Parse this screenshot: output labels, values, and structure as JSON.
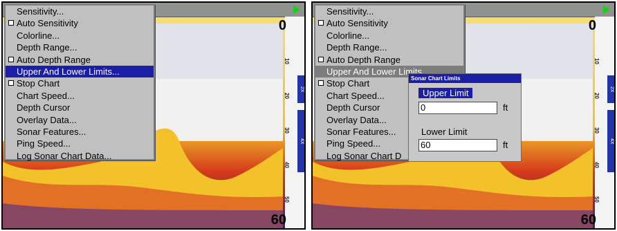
{
  "left": {
    "menu": {
      "items": [
        {
          "label": "Sensitivity...",
          "checkbox": false,
          "state": "normal"
        },
        {
          "label": "Auto Sensitivity",
          "checkbox": true,
          "state": "normal"
        },
        {
          "label": "Colorline...",
          "checkbox": false,
          "state": "normal"
        },
        {
          "label": "Depth Range...",
          "checkbox": false,
          "state": "normal"
        },
        {
          "label": "Auto Depth Range",
          "checkbox": true,
          "state": "normal"
        },
        {
          "label": "Upper And Lower Limits...",
          "checkbox": false,
          "state": "selected"
        },
        {
          "label": "Stop Chart",
          "checkbox": true,
          "state": "normal"
        },
        {
          "label": "Chart Speed...",
          "checkbox": false,
          "state": "normal"
        },
        {
          "label": "Depth Cursor",
          "checkbox": false,
          "state": "normal"
        },
        {
          "label": "Overlay Data...",
          "checkbox": false,
          "state": "normal"
        },
        {
          "label": "Sonar Features...",
          "checkbox": false,
          "state": "normal"
        },
        {
          "label": "Ping Speed...",
          "checkbox": false,
          "state": "normal"
        },
        {
          "label": "Log Sonar Chart Data...",
          "checkbox": false,
          "state": "normal"
        }
      ]
    },
    "depth_top": "0",
    "depth_bottom": "60",
    "scale_labels": [
      "10",
      "20",
      "30",
      "40",
      "50"
    ],
    "zoom_labels": [
      "2X",
      "4X"
    ]
  },
  "right": {
    "menu": {
      "items": [
        {
          "label": "Sensitivity...",
          "checkbox": false,
          "state": "normal"
        },
        {
          "label": "Auto Sensitivity",
          "checkbox": true,
          "state": "normal"
        },
        {
          "label": "Colorline...",
          "checkbox": false,
          "state": "normal"
        },
        {
          "label": "Depth Range...",
          "checkbox": false,
          "state": "normal"
        },
        {
          "label": "Auto Depth Range",
          "checkbox": true,
          "state": "normal"
        },
        {
          "label": "Upper And Lower Limits",
          "checkbox": false,
          "state": "dim"
        },
        {
          "label": "Stop Chart",
          "checkbox": true,
          "state": "normal"
        },
        {
          "label": "Chart Speed...",
          "checkbox": false,
          "state": "normal"
        },
        {
          "label": "Depth Cursor",
          "checkbox": false,
          "state": "normal"
        },
        {
          "label": "Overlay Data...",
          "checkbox": false,
          "state": "normal"
        },
        {
          "label": "Sonar Features...",
          "checkbox": false,
          "state": "normal"
        },
        {
          "label": "Ping Speed...",
          "checkbox": false,
          "state": "normal"
        },
        {
          "label": "Log Sonar Chart D",
          "checkbox": false,
          "state": "normal"
        }
      ]
    },
    "dialog": {
      "title": "Sonar Chart Limits",
      "upper_label": "Upper Limit",
      "upper_value": "0",
      "lower_label": "Lower Limit",
      "lower_value": "60",
      "unit": "ft"
    },
    "depth_top": "0",
    "depth_bottom": "60",
    "scale_labels": [
      "10",
      "20",
      "30",
      "40",
      "50"
    ],
    "zoom_labels": [
      "2X",
      "4X"
    ]
  },
  "colors": {
    "menu_bg": "#c0c0c0",
    "selection": "#1b1ea6",
    "sonar_hot": "#f4d23a",
    "sonar_cold": "#3a1d6e"
  }
}
